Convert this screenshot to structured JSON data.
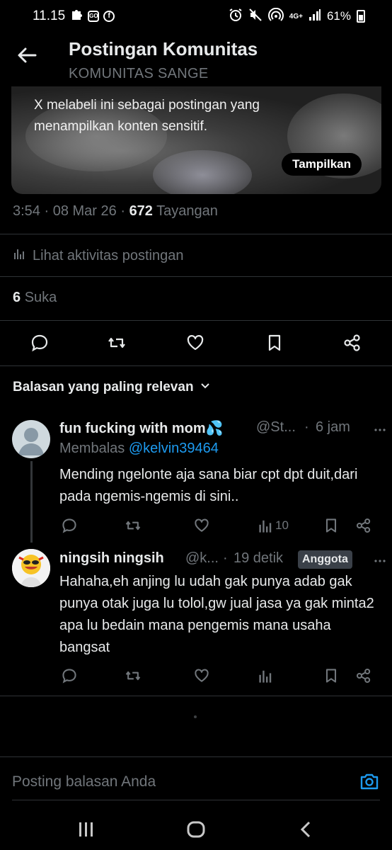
{
  "status_bar": {
    "time": "11.15",
    "battery": "61%",
    "network": "4G+"
  },
  "header": {
    "title": "Postingan Komunitas",
    "subtitle": "KOMUNITAS SANGE"
  },
  "sensitive_card": {
    "message": "X melabeli ini sebagai postingan yang menampilkan konten sensitif.",
    "show_button": "Tampilkan"
  },
  "post_meta": {
    "time": "3:54",
    "date": "08 Mar 26",
    "views_count": "672",
    "views_label": "Tayangan",
    "activity_label": "Lihat aktivitas postingan",
    "likes_count": "6",
    "likes_label": "Suka"
  },
  "replies_sort": {
    "label": "Balasan yang paling relevan"
  },
  "replies": [
    {
      "name": "fun fucking with mom💦",
      "handle": "@St...",
      "time": "6 jam",
      "replying_to_label": "Membalas",
      "replying_to_handle": "@kelvin39464",
      "text": "Mending ngelonte aja sana biar cpt dpt duit,dari pada ngemis-ngemis di sini..",
      "views": "10"
    },
    {
      "name": "ningsih ningsih",
      "handle": "@k...",
      "time": "19 detik",
      "badge": "Anggota",
      "text": "Hahaha,eh anjing lu udah gak punya adab gak punya otak juga lu tolol,gw jual jasa ya gak minta2 apa lu bedain mana pengemis mana usaha bangsat"
    }
  ],
  "composer": {
    "placeholder": "Posting balasan Anda"
  },
  "colors": {
    "background": "#000000",
    "text_primary": "#e7e9ea",
    "text_secondary": "#71767b",
    "link": "#1d9bf0",
    "divider": "#2f3336"
  }
}
